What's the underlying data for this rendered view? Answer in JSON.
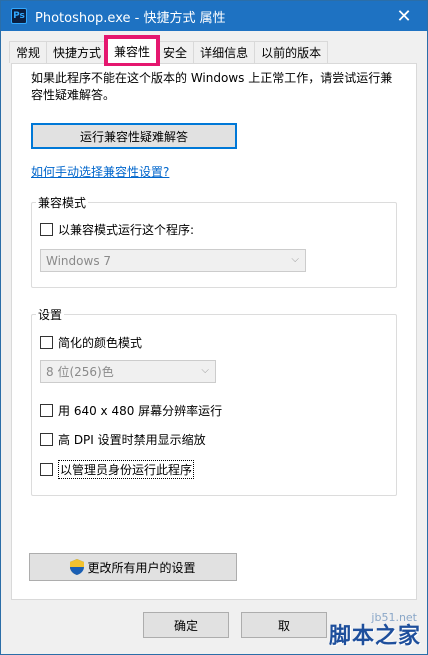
{
  "window": {
    "title": "Photoshop.exe - 快捷方式 属性",
    "app_icon_text": "Ps",
    "close_glyph": "✕"
  },
  "tabs": [
    {
      "label": "常规"
    },
    {
      "label": "快捷方式"
    },
    {
      "label": "兼容性"
    },
    {
      "label": "安全"
    },
    {
      "label": "详细信息"
    },
    {
      "label": "以前的版本"
    }
  ],
  "active_tab": "兼容性",
  "compat": {
    "intro": "如果此程序不能在这个版本的 Windows 上正常工作，请尝试运行兼容性疑难解答。",
    "run_troubleshooter": "运行兼容性疑难解答",
    "manual_link": "如何手动选择兼容性设置?",
    "mode_group": {
      "title": "兼容模式",
      "checkbox_label": "以兼容模式运行这个程序:",
      "checked": false,
      "select_value": "Windows 7"
    },
    "settings_group": {
      "title": "设置",
      "reduced_color_label": "简化的颜色模式",
      "color_select_value": "8 位(256)色",
      "res_640_label": "用 640 x 480 屏幕分辨率运行",
      "high_dpi_label": "高 DPI 设置时禁用显示缩放",
      "run_as_admin_label": "以管理员身份运行此程序",
      "checks": [
        false,
        false,
        false,
        false
      ]
    },
    "all_users_button": "更改所有用户的设置"
  },
  "footer": {
    "ok_label": "确定",
    "cancel_label": "取"
  },
  "watermark": {
    "main": "脚本之家",
    "sub": "jb51.net"
  },
  "colors": {
    "title_bar": "#1e72c2",
    "highlight": "#e5176f",
    "link": "#0066cc"
  }
}
